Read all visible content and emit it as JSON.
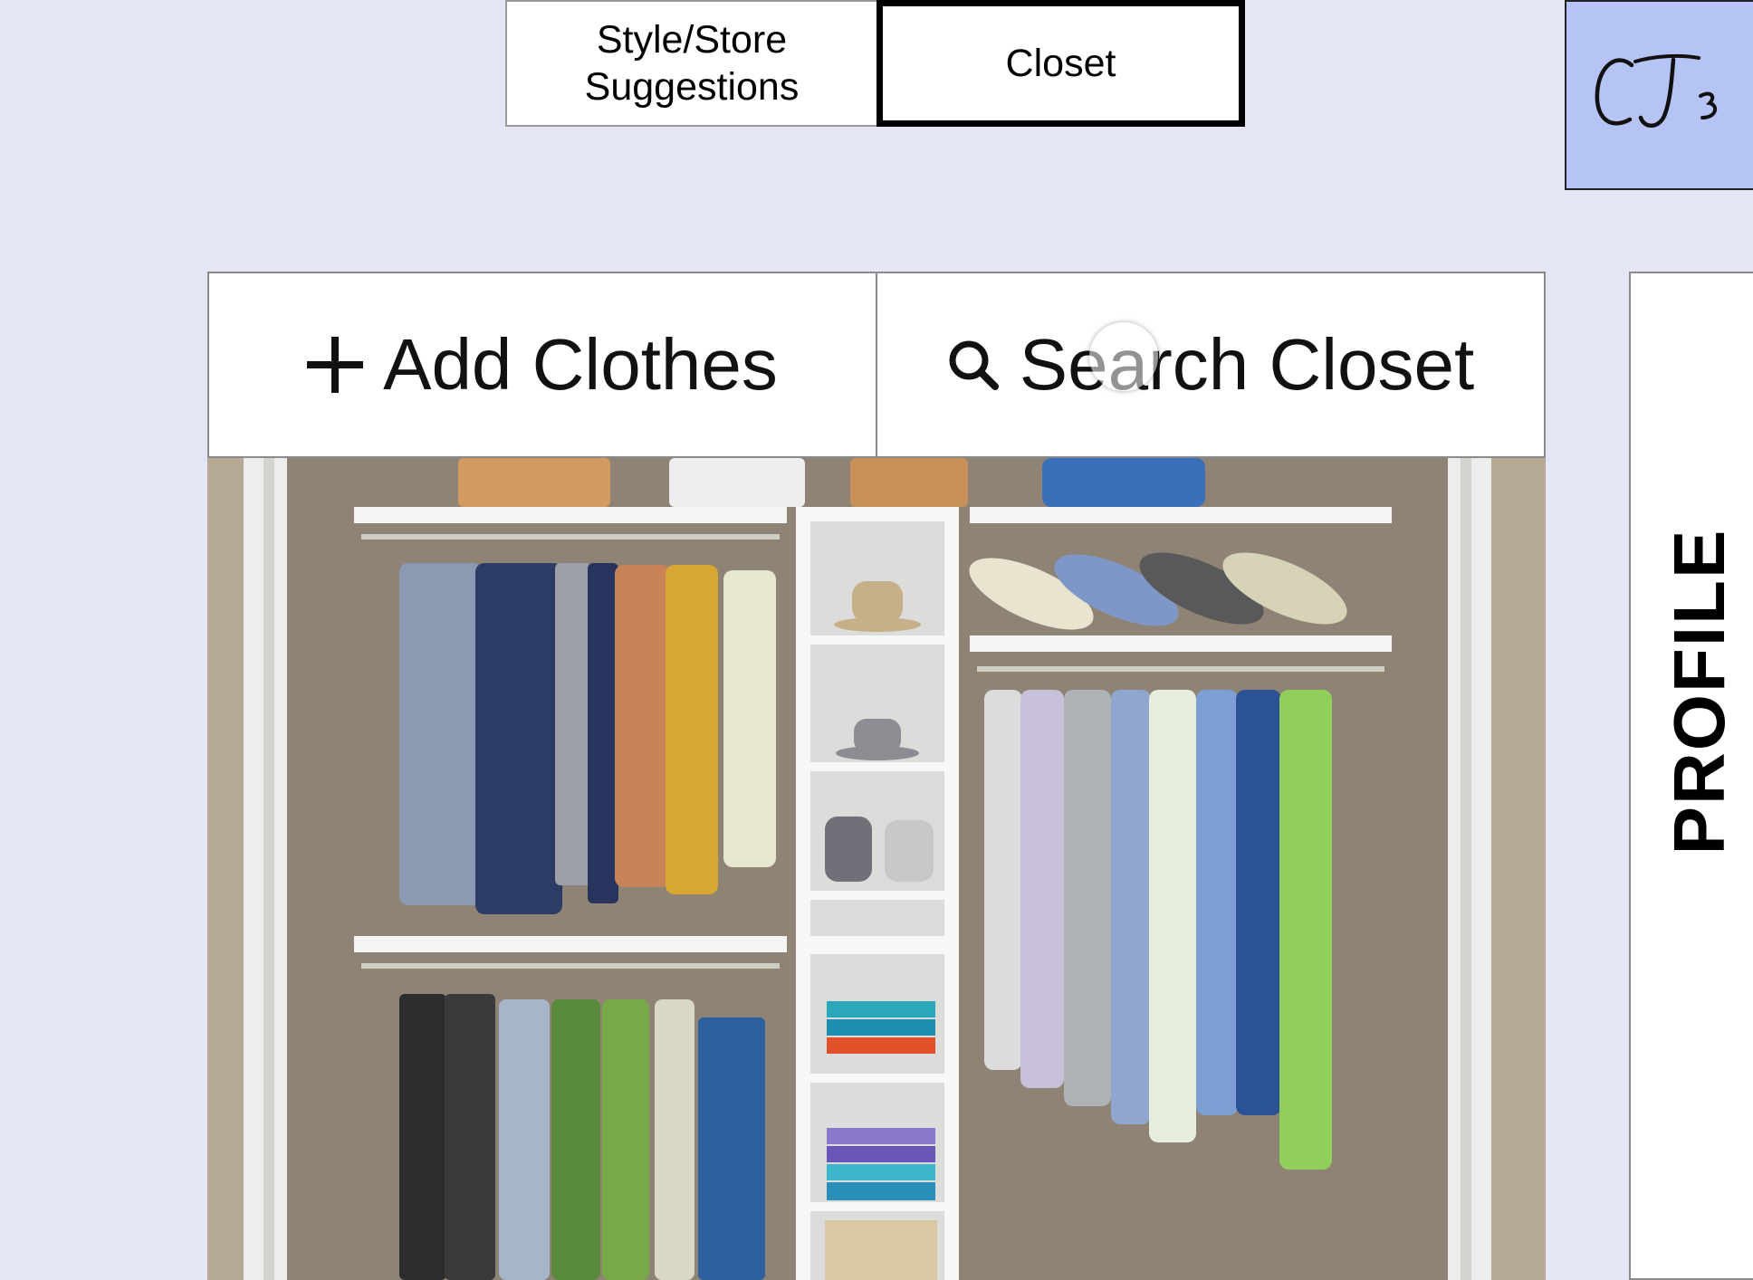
{
  "tabs": [
    {
      "label": "Style/Store\nSuggestions",
      "active": false
    },
    {
      "label": "Closet",
      "active": true
    }
  ],
  "logo": {
    "text": "CJ3"
  },
  "actions": {
    "add_label": "Add Clothes",
    "add_icon": "plus-icon",
    "search_label": "Search Closet",
    "search_icon": "search-icon"
  },
  "closet": {
    "image": "closet-organizer-photo"
  },
  "profile": {
    "label": "PROFILE"
  },
  "colors": {
    "background": "#e4e6f5",
    "logo_bg": "#b6c3f5",
    "active_tab_border": "#000000"
  }
}
